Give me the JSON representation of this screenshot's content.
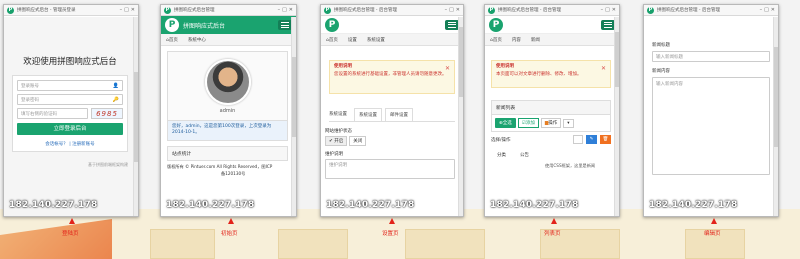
{
  "ip": "182.140.227.178",
  "colors": {
    "brand": "#1aa36f",
    "annotation": "#e2231a",
    "ip_text": "#ffffff"
  },
  "annotations": [
    "登陆页",
    "初始页",
    "设置页",
    "列表页",
    "编辑页"
  ],
  "login": {
    "title": "拼图响应式后台 - 管理员登录",
    "heading": "欢迎使用拼图响应式后台",
    "account_placeholder": "登录账号",
    "password_placeholder": "登录密码",
    "captcha_placeholder": "填写右侧的验证码",
    "captcha_code": "6985",
    "login_button": "立即登录后台",
    "links": "会话帐号？ | 注册新账号",
    "footer": "基于拼图前端框架构建"
  },
  "home": {
    "title": "拼图响应式后台管理",
    "app_name": "拼图响应式后台",
    "crumbs": [
      "首页",
      "系统中心"
    ],
    "username": "admin",
    "welcome": "您好，admin，这是您第100次登录，上次登录为2014-10-1。",
    "section": "站点统计",
    "footer": "版权所有 © Pintuer.com All Rights Reserved，图ICP",
    "footer2": "备120130号"
  },
  "settings": {
    "title": "拼图响应式后台管理 - 后台管理",
    "crumbs": [
      "首页",
      "设置",
      "系统设置"
    ],
    "alert_title": "使用说明",
    "alert_text": "您设置的系统进行基础设置，非管理人员请勿随意更改。",
    "tabs": [
      "系统设置",
      "系统设置",
      "邮件设置"
    ],
    "status_label": "网站维护状态",
    "on": "开启",
    "off": "关闭",
    "maint_label": "维护说明",
    "maint_placeholder": "维护说明"
  },
  "list": {
    "title": "拼图响应式后台管理 - 后台管理",
    "crumbs": [
      "首页",
      "内容",
      "新闻"
    ],
    "alert_title": "使用说明",
    "alert_text": "本页面可以对文章进行删除、修改、增加。",
    "section": "新闻列表",
    "btn_select": "全选",
    "btn_add": "添加",
    "btn_ops": "操作",
    "col_select": "选择/操作",
    "col_category": "分类",
    "cell_category": "公告",
    "cell_text": "使用CSS框架，这里是新闻"
  },
  "edit": {
    "title": "拼图响应式后台管理 - 后台管理",
    "title_label": "新闻标题",
    "title_placeholder": "输入新闻标题",
    "content_label": "新闻内容",
    "content_placeholder": "输入新闻内容"
  }
}
